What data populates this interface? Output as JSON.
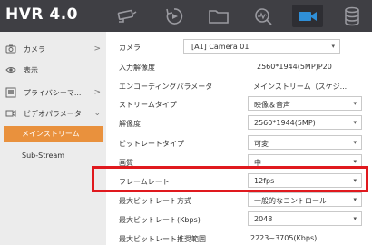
{
  "header": {
    "logo": "HVR 4.0",
    "icons": [
      "camera-icon",
      "playback-icon",
      "folder-icon",
      "search-icon",
      "video-icon",
      "storage-icon"
    ],
    "active_icon": "video-icon"
  },
  "colors": {
    "accent": "#e9913d",
    "topbar": "#3f3f44",
    "highlight": "#e0191e",
    "sidebar": "#ececec"
  },
  "sidebar": {
    "items": [
      {
        "label": "カメラ",
        "icon": "camera-icon",
        "arrow": ">"
      },
      {
        "label": "表示",
        "icon": "eye-icon",
        "arrow": ""
      },
      {
        "label": "プライバシーマ...",
        "icon": "privacy-mask-icon",
        "arrow": ">"
      },
      {
        "label": "ビデオパラメータ",
        "icon": "video-params-icon",
        "arrow": "⌄"
      }
    ],
    "subitems": [
      {
        "label": "メインストリーム",
        "selected": true
      },
      {
        "label": "Sub-Stream",
        "selected": false
      }
    ]
  },
  "form": {
    "camera": {
      "label": "カメラ",
      "value": "[A1] Camera 01"
    },
    "input_resolution": {
      "label": "入力解像度",
      "value": "2560*1944(5MP)P20"
    },
    "encoding_params": {
      "label": "エンコーディングパラメータ",
      "value": "メインストリーム（スケジ..."
    },
    "stream_type": {
      "label": "ストリームタイプ",
      "value": "映像＆音声"
    },
    "resolution": {
      "label": "解像度",
      "value": "2560*1944(5MP)"
    },
    "bitrate_type": {
      "label": "ビットレートタイプ",
      "value": "可変"
    },
    "quality": {
      "label": "画質",
      "value": "中"
    },
    "frame_rate": {
      "label": "フレームレート",
      "value": "12fps"
    },
    "max_bitrate_mode": {
      "label": "最大ビットレート方式",
      "value": "一般的なコントロール"
    },
    "max_bitrate": {
      "label": "最大ビットレート(Kbps)",
      "value": "2048"
    },
    "recommended_range": {
      "label": "最大ビットレート推奨範囲",
      "value": "2223~3705(Kbps)"
    }
  }
}
